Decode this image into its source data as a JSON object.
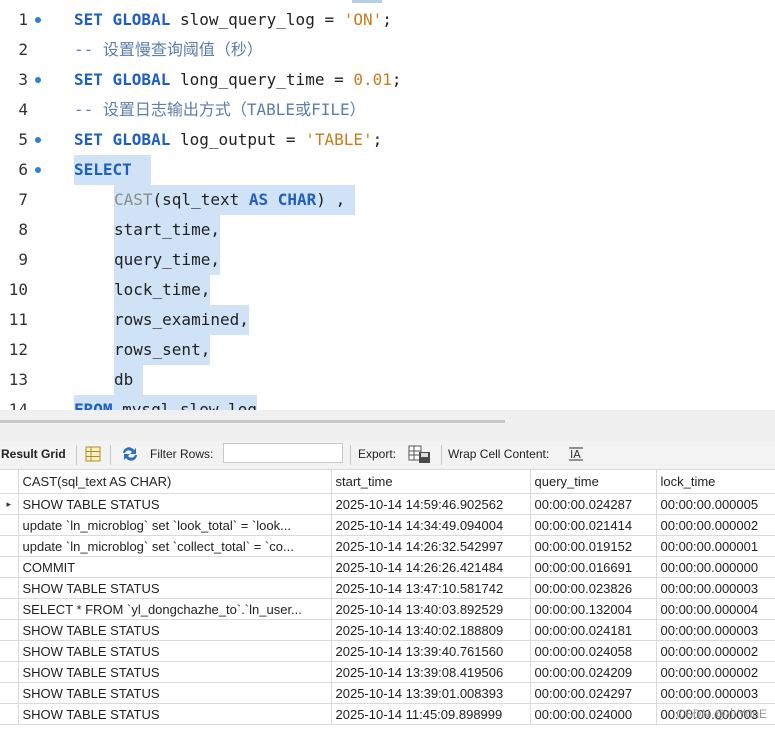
{
  "editor": {
    "lines": [
      {
        "n": "1",
        "bp": true,
        "indent": 0,
        "sel": false,
        "tokens": [
          {
            "t": "kw",
            "v": "SET GLOBAL"
          },
          {
            "t": "plain",
            "v": " slow_query_log = "
          },
          {
            "t": "str",
            "v": "'ON'"
          },
          {
            "t": "plain",
            "v": ";"
          }
        ]
      },
      {
        "n": "2",
        "bp": false,
        "indent": 0,
        "sel": false,
        "tokens": [
          {
            "t": "cm",
            "v": "-- 设置慢查询阈值（秒）"
          }
        ]
      },
      {
        "n": "3",
        "bp": true,
        "indent": 0,
        "sel": false,
        "tokens": [
          {
            "t": "kw",
            "v": "SET GLOBAL"
          },
          {
            "t": "plain",
            "v": " long_query_time = "
          },
          {
            "t": "num",
            "v": "0.01"
          },
          {
            "t": "plain",
            "v": ";"
          }
        ]
      },
      {
        "n": "4",
        "bp": false,
        "indent": 0,
        "sel": false,
        "tokens": [
          {
            "t": "cm",
            "v": "-- 设置日志输出方式（TABLE或FILE）"
          }
        ]
      },
      {
        "n": "5",
        "bp": true,
        "indent": 0,
        "sel": false,
        "tokens": [
          {
            "t": "kw",
            "v": "SET GLOBAL"
          },
          {
            "t": "plain",
            "v": " log_output = "
          },
          {
            "t": "str",
            "v": "'TABLE'"
          },
          {
            "t": "plain",
            "v": ";"
          }
        ]
      },
      {
        "n": "6",
        "bp": true,
        "indent": 0,
        "sel": true,
        "tokens": [
          {
            "t": "kw",
            "v": "SELECT"
          },
          {
            "t": "plain",
            "v": "  "
          }
        ]
      },
      {
        "n": "7",
        "bp": false,
        "indent": 1,
        "sel": true,
        "tokens": [
          {
            "t": "fn",
            "v": "CAST"
          },
          {
            "t": "plain",
            "v": "(sql_text "
          },
          {
            "t": "kw",
            "v": "AS"
          },
          {
            "t": "plain",
            "v": " "
          },
          {
            "t": "kw",
            "v": "CHAR"
          },
          {
            "t": "plain",
            "v": ") , "
          }
        ]
      },
      {
        "n": "8",
        "bp": false,
        "indent": 1,
        "sel": true,
        "tokens": [
          {
            "t": "plain",
            "v": "start_time,"
          }
        ]
      },
      {
        "n": "9",
        "bp": false,
        "indent": 1,
        "sel": true,
        "tokens": [
          {
            "t": "plain",
            "v": "query_time,"
          }
        ]
      },
      {
        "n": "10",
        "bp": false,
        "indent": 1,
        "sel": true,
        "tokens": [
          {
            "t": "plain",
            "v": "lock_time,"
          }
        ]
      },
      {
        "n": "11",
        "bp": false,
        "indent": 1,
        "sel": true,
        "tokens": [
          {
            "t": "plain",
            "v": "rows_examined,"
          }
        ]
      },
      {
        "n": "12",
        "bp": false,
        "indent": 1,
        "sel": true,
        "tokens": [
          {
            "t": "plain",
            "v": "rows_sent,"
          }
        ]
      },
      {
        "n": "13",
        "bp": false,
        "indent": 1,
        "sel": true,
        "tokens": [
          {
            "t": "plain",
            "v": "db "
          }
        ]
      },
      {
        "n": "14",
        "bp": false,
        "indent": 0,
        "sel": true,
        "tokens": [
          {
            "t": "kw",
            "v": "FROM"
          },
          {
            "t": "plain",
            "v": " mysql.slow_log"
          }
        ]
      }
    ]
  },
  "toolbar": {
    "result_grid": "Result Grid",
    "filter_rows": "Filter Rows:",
    "filter_value": "",
    "export": "Export:",
    "wrap": "Wrap Cell Content:",
    "accent": "#1c5fb5"
  },
  "grid": {
    "columns": [
      "CAST(sql_text AS CHAR)",
      "start_time",
      "query_time",
      "lock_time"
    ],
    "current_row_marker": "▸",
    "rows": [
      [
        "SHOW TABLE STATUS",
        "2025-10-14 14:59:46.902562",
        "00:00:00.024287",
        "00:00:00.000005"
      ],
      [
        "update `ln_microblog` set `look_total` = `look...",
        "2025-10-14 14:34:49.094004",
        "00:00:00.021414",
        "00:00:00.000002"
      ],
      [
        "update `ln_microblog` set `collect_total` = `co...",
        "2025-10-14 14:26:32.542997",
        "00:00:00.019152",
        "00:00:00.000001"
      ],
      [
        "COMMIT",
        "2025-10-14 14:26:26.421484",
        "00:00:00.016691",
        "00:00:00.000000"
      ],
      [
        "SHOW TABLE STATUS",
        "2025-10-14 13:47:10.581742",
        "00:00:00.023826",
        "00:00:00.000003"
      ],
      [
        "SELECT * FROM `yl_dongchazhe_to`.`ln_user...",
        "2025-10-14 13:40:03.892529",
        "00:00:00.132004",
        "00:00:00.000004"
      ],
      [
        "SHOW TABLE STATUS",
        "2025-10-14 13:40:02.188809",
        "00:00:00.024181",
        "00:00:00.000003"
      ],
      [
        "SHOW TABLE STATUS",
        "2025-10-14 13:39:40.761560",
        "00:00:00.024058",
        "00:00:00.000002"
      ],
      [
        "SHOW TABLE STATUS",
        "2025-10-14 13:39:08.419506",
        "00:00:00.024209",
        "00:00:00.000002"
      ],
      [
        "SHOW TABLE STATUS",
        "2025-10-14 13:39:01.008393",
        "00:00:00.024297",
        "00:00:00.000003"
      ],
      [
        "SHOW TABLE STATUS",
        "2025-10-14 11:45:09.898999",
        "00:00:00.024000",
        "00:00:00.000003"
      ]
    ]
  },
  "watermark": "CSDN @小Y0nE"
}
